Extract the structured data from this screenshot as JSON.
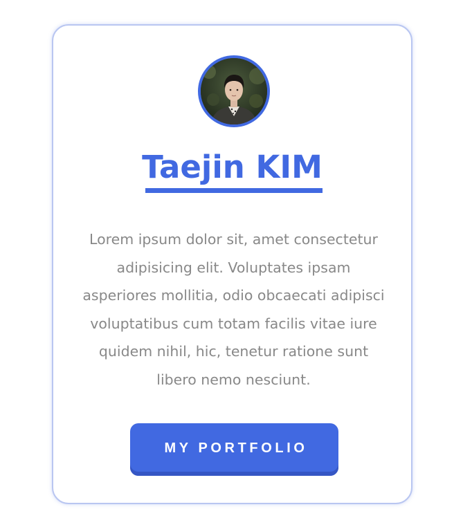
{
  "profile": {
    "avatar_icon": "person-photo",
    "name": "Taejin KIM",
    "bio": "Lorem ipsum dolor sit, amet consectetur adipisicing elit. Voluptates ipsam asperiores mollitia, odio obcaecati adipisci voluptatibus cum totam facilis vitae iure quidem nihil, hic, tenetur ratione sunt libero nemo nesciunt."
  },
  "actions": {
    "portfolio_label": "MY PORTFOLIO"
  },
  "colors": {
    "accent": "#4169e1",
    "text_muted": "#888888",
    "card_border": "#b9c6f1",
    "background": "#ffffff"
  }
}
